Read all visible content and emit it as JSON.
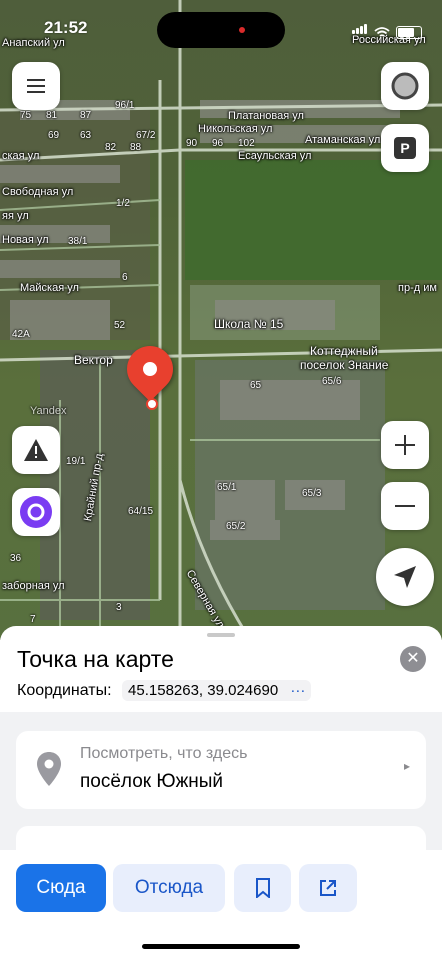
{
  "status": {
    "time": "21:52"
  },
  "map": {
    "labels": {
      "anapsky": "Анапский ул",
      "rossiyskaya": "Российская ул",
      "platanovaya": "Платановая ул",
      "nikolskaya": "Никольская ул",
      "atamanskaya": "Атаманская ул",
      "esaulskaya": "Есаульская ул",
      "skaya": "ская ул",
      "svobodnaya": "Свободная ул",
      "yaya": "яя ул",
      "novaya": "Новая ул",
      "mayskaya": "Майская ул",
      "pr_dm": "пр-д им",
      "school": "Школа № 15",
      "vektor": "Вектор",
      "cottage": "Коттеджный",
      "cottage2": "поселок Знание",
      "krayniy": "Крайний пр-д",
      "severnaya": "Северная ул",
      "zabornaya": "заборная ул",
      "yandex": "Yandex"
    },
    "numbers": [
      "75",
      "81",
      "87",
      "96/1",
      "69",
      "63",
      "67/2",
      "82",
      "88",
      "96",
      "90",
      "102",
      "38/1",
      "1/2",
      "52",
      "6",
      "65",
      "65/6",
      "19/1",
      "64/15",
      "65/1",
      "65/3",
      "65/2",
      "36",
      "3",
      "7",
      "42А"
    ]
  },
  "sheet": {
    "title": "Точка на карте",
    "coords_label": "Координаты:",
    "coords_value": "45.158263, 39.024690",
    "coords_more": "···",
    "close": "✕",
    "lookup_sub": "Посмотреть, что здесь",
    "lookup_main": "посёлок Южный",
    "chevron": "▸"
  },
  "actions": {
    "to_here": "Сюда",
    "from_here": "Отсюда"
  },
  "colors": {
    "accent": "#1a73e8",
    "pin": "#e8402e",
    "secondary_bg": "#e8eefc"
  },
  "icons": [
    "menu-icon",
    "speedometer-icon",
    "parking-icon",
    "warning-icon",
    "alice-icon",
    "zoom-in-icon",
    "zoom-out-icon",
    "location-arrow-icon",
    "place-pin-icon",
    "bookmark-icon",
    "share-icon"
  ]
}
